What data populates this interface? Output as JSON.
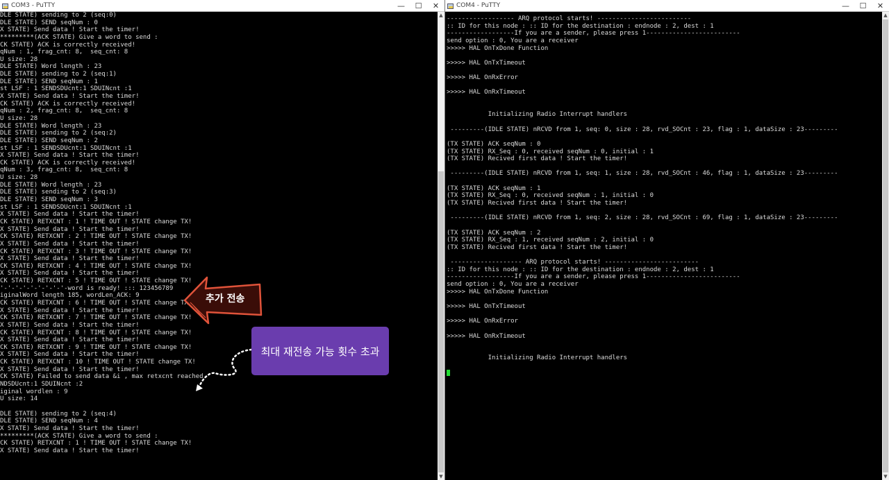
{
  "left_window": {
    "title": "COM3 - PuTTY",
    "lines": [
      "DLE STATE) sending to 2 (seq:0)",
      "DLE STATE) SEND seqNum : 0",
      "X STATE) Send data ! Start the timer!",
      "*********(ACK STATE) Give a word to send :",
      "CK STATE) ACK is correctly received!",
      "qNum : 1, frag_cnt: 8,  seq_cnt: 8",
      "U size: 28",
      "DLE STATE) Word length : 23",
      "DLE STATE) sending to 2 (seq:1)",
      "DLE STATE) SEND seqNum : 1",
      "st LSF : 1 SENDSDUcnt:1 SDUINcnt :1",
      "X STATE) Send data ! Start the timer!",
      "CK STATE) ACK is correctly received!",
      "qNum : 2, frag_cnt: 8,  seq_cnt: 8",
      "U size: 28",
      "DLE STATE) Word length : 23",
      "DLE STATE) sending to 2 (seq:2)",
      "DLE STATE) SEND seqNum : 2",
      "st LSF : 1 SENDSDUcnt:1 SDUINcnt :1",
      "X STATE) Send data ! Start the timer!",
      "CK STATE) ACK is correctly received!",
      "qNum : 3, frag_cnt: 8,  seq_cnt: 8",
      "U size: 28",
      "DLE STATE) Word length : 23",
      "DLE STATE) sending to 2 (seq:3)",
      "DLE STATE) SEND seqNum : 3",
      "st LSF : 1 SENDSDUcnt:1 SDUINcnt :1",
      "X STATE) Send data ! Start the timer!",
      "CK STATE) RETXCNT : 1 ! TIME OUT ! STATE change TX!",
      "X STATE) Send data ! Start the timer!",
      "CK STATE) RETXCNT : 2 ! TIME OUT ! STATE change TX!",
      "X STATE) Send data ! Start the timer!",
      "CK STATE) RETXCNT : 3 ! TIME OUT ! STATE change TX!",
      "X STATE) Send data ! Start the timer!",
      "CK STATE) RETXCNT : 4 ! TIME OUT ! STATE change TX!",
      "X STATE) Send data ! Start the timer!",
      "CK STATE) RETXCNT : 5 ! TIME OUT ! STATE change TX!",
      "'-'-'-'-'-'-'-'-'-word is ready! ::: 123456789",
      "iginalWord length 185, wordLen_ACK: 9",
      "CK STATE) RETXCNT : 6 ! TIME OUT ! STATE change TX!",
      "X STATE) Send data ! Start the timer!",
      "CK STATE) RETXCNT : 7 ! TIME OUT ! STATE change TX!",
      "X STATE) Send data ! Start the timer!",
      "CK STATE) RETXCNT : 8 ! TIME OUT ! STATE change TX!",
      "X STATE) Send data ! Start the timer!",
      "CK STATE) RETXCNT : 9 ! TIME OUT ! STATE change TX!",
      "X STATE) Send data ! Start the timer!",
      "CK STATE) RETXCNT : 10 ! TIME OUT ! STATE change TX!",
      "X STATE) Send data ! Start the timer!",
      "CK STATE) Failed to send data &i , max retxcnt reached",
      "NDSDUcnt:1 SDUINcnt :2",
      "iginal wordlen : 9",
      "U size: 14",
      "",
      "DLE STATE) sending to 2 (seq:4)",
      "DLE STATE) SEND seqNum : 4",
      "X STATE) Send data ! Start the timer!",
      "*********(ACK STATE) Give a word to send :",
      "CK STATE) RETXCNT : 1 ! TIME OUT ! STATE change TX!",
      "X STATE) Send data ! Start the timer!"
    ]
  },
  "right_window": {
    "title": "COM4 - PuTTY",
    "lines": [
      "------------------ ARQ protocol starts! -------------------------",
      ":: ID for this node : :: ID for the destination : endnode : 2, dest : 1",
      "------------------If you are a sender, please press 1-------------------------",
      "send option : 0, You are a receiver",
      ">>>>> HAL OnTxDone Function",
      "",
      ">>>>> HAL OnTxTimeout",
      "",
      ">>>>> HAL OnRxError",
      "",
      ">>>>> HAL OnRxTimeout",
      "",
      "",
      "           Initializing Radio Interrupt handlers",
      "",
      " ---------(IDLE STATE) nRCVD from 1, seq: 0, size : 28, rvd_SOCnt : 23, flag : 1, dataSize : 23---------",
      "",
      "(TX STATE) ACK seqNum : 0",
      "(TX STATE) RX_Seq : 0, received seqNum : 0, initial : 1",
      "(TX STATE) Recived first data ! Start the timer!",
      "",
      " ---------(IDLE STATE) nRCVD from 1, seq: 1, size : 28, rvd_SOCnt : 46, flag : 1, dataSize : 23---------",
      "",
      "(TX STATE) ACK seqNum : 1",
      "(TX STATE) RX_Seq : 0, received seqNum : 1, initial : 0",
      "(TX STATE) Recived first data ! Start the timer!",
      "",
      " ---------(IDLE STATE) nRCVD from 1, seq: 2, size : 28, rvd_SOCnt : 69, flag : 1, dataSize : 23---------",
      "",
      "(TX STATE) ACK seqNum : 2",
      "(TX STATE) RX_Seq : 1, received seqNum : 2, initial : 0",
      "(TX STATE) Recived first data ! Start the timer!",
      "",
      " ------------------- ARQ protocol starts! -------------------------",
      ":: ID for this node : :: ID for the destination : endnode : 2, dest : 1",
      "------------------If you are a sender, please press 1-------------------------",
      "send option : 0, You are a receiver",
      ">>>>> HAL OnTxDone Function",
      "",
      ">>>>> HAL OnTxTimeout",
      "",
      ">>>>> HAL OnRxError",
      "",
      ">>>>> HAL OnRxTimeout",
      "",
      "",
      "           Initializing Radio Interrupt handlers",
      ""
    ]
  },
  "annotations": {
    "arrow_label": "추가 전송",
    "box_label": "최대 재전송 가능 횟수 초과"
  },
  "controls": {
    "minimize": "—",
    "maximize": "☐",
    "close": "✕"
  },
  "colors": {
    "cursor": "#22dd33",
    "annotation_box": "#6a3dae",
    "arrow": "#e0533a"
  }
}
